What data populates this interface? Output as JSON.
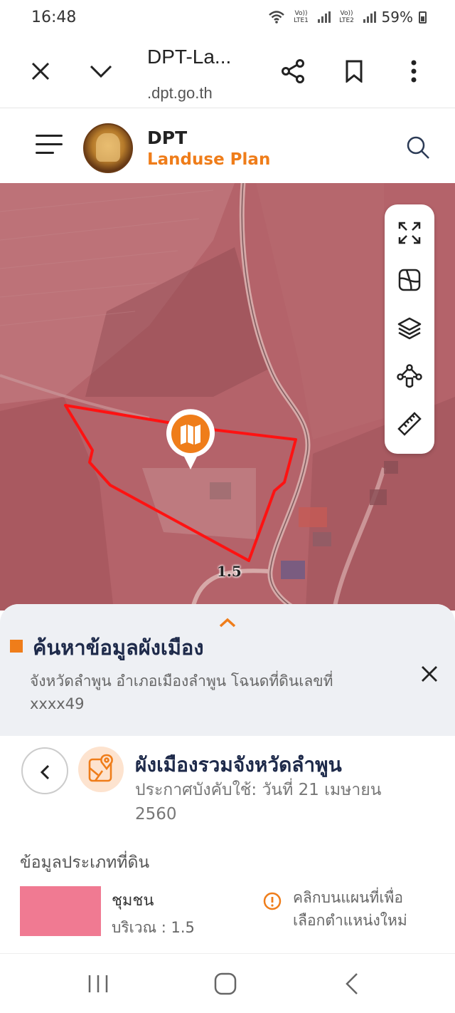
{
  "status_bar": {
    "time": "16:48",
    "sim1": "Vo)) LTE1",
    "sim2": "Vo)) LTE2",
    "battery": "59%"
  },
  "browser": {
    "title": "DPT-La...",
    "url": ".dpt.go.th"
  },
  "site": {
    "brand": "DPT",
    "subtitle": "Landuse Plan",
    "logo_text": "กรมโยธาธิการและผังเมือง",
    "accent_color": "#ef7d1a"
  },
  "map": {
    "zone_label": "1.5",
    "tools": [
      "fullscreen-icon",
      "basemap-icon",
      "layers-icon",
      "draw-polygon-icon",
      "ruler-icon"
    ],
    "overlay_color": "#b25f62",
    "parcel_outline_color": "#ff1a1a"
  },
  "sheet": {
    "title": "ค้นหาข้อมูลผังเมือง",
    "description": "จังหวัดลำพูน อำเภอเมืองลำพูน โฉนดที่ดินเลขที่ xxxx49",
    "plan_title": "ผังเมืองรวมจังหวัดลำพูน",
    "plan_date": "ประกาศบังคับใช้: วันที่ 21 เมษายน 2560",
    "landtype_heading": "ข้อมูลประเภทที่ดิน",
    "zone_name": "ชุมชน",
    "zone_area": "บริเวณ : 1.5",
    "zone_color": "#f07a92",
    "info_text": "คลิกบนแผนที่เพื่อเลือกตำแหน่งใหม่"
  }
}
